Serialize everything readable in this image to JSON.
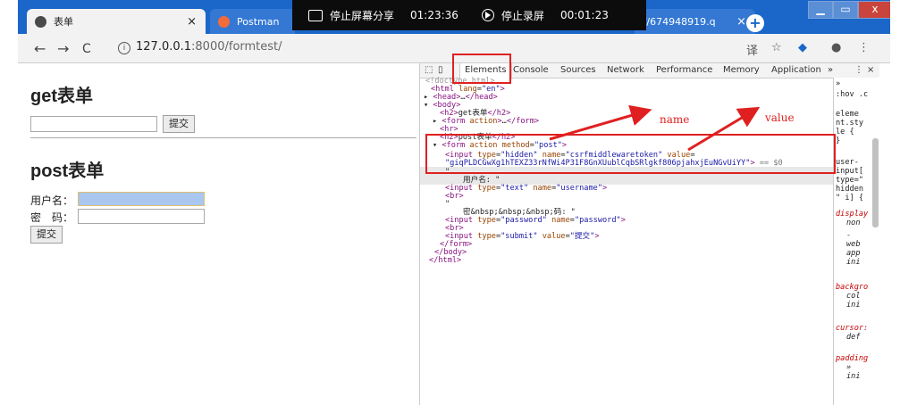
{
  "browser": {
    "tabs": [
      {
        "title": "表单",
        "close": "×"
      },
      {
        "title": "Postman"
      },
      {
        "title": "://674948919.q",
        "close": "×"
      }
    ],
    "new_tab": "+",
    "window_controls": {
      "min": "▁",
      "max": "▭",
      "close": "x"
    },
    "address": {
      "host": "127.0.0.1",
      "rest": ":8000/formtest/"
    },
    "nav": {
      "back": "←",
      "forward": "→",
      "reload": "C",
      "info": "i"
    },
    "toolbar_icons": [
      "translate-icon",
      "star-icon",
      "extension-icon",
      "profile-icon",
      "menu-icon"
    ]
  },
  "recorder": {
    "share_label": "停止屏幕分享",
    "share_time": "01:23:36",
    "record_label": "停止录屏",
    "record_time": "00:01:23"
  },
  "page": {
    "get_title": "get表单",
    "get_submit": "提交",
    "post_title": "post表单",
    "username_label": "用户名：",
    "password_label": "密　码：",
    "post_submit": "提交"
  },
  "devtools": {
    "tabs": [
      "Elements",
      "Console",
      "Sources",
      "Network",
      "Performance",
      "Memory",
      "Application"
    ],
    "more": "»",
    "menu": "⋮",
    "close": "×",
    "styles_lines": [
      "»",
      ":hov .c",
      "eleme",
      "nt.sty",
      "le {",
      "}",
      "user-",
      "input[",
      "type=\"",
      "hidden",
      "\" i] {",
      "display",
      "non",
      "-",
      "web",
      "app",
      "ini",
      "backgro",
      "col",
      "ini",
      "cursor:",
      "def",
      "padding",
      "»",
      "ini"
    ]
  },
  "annotations": {
    "name": "name",
    "value": "value"
  }
}
